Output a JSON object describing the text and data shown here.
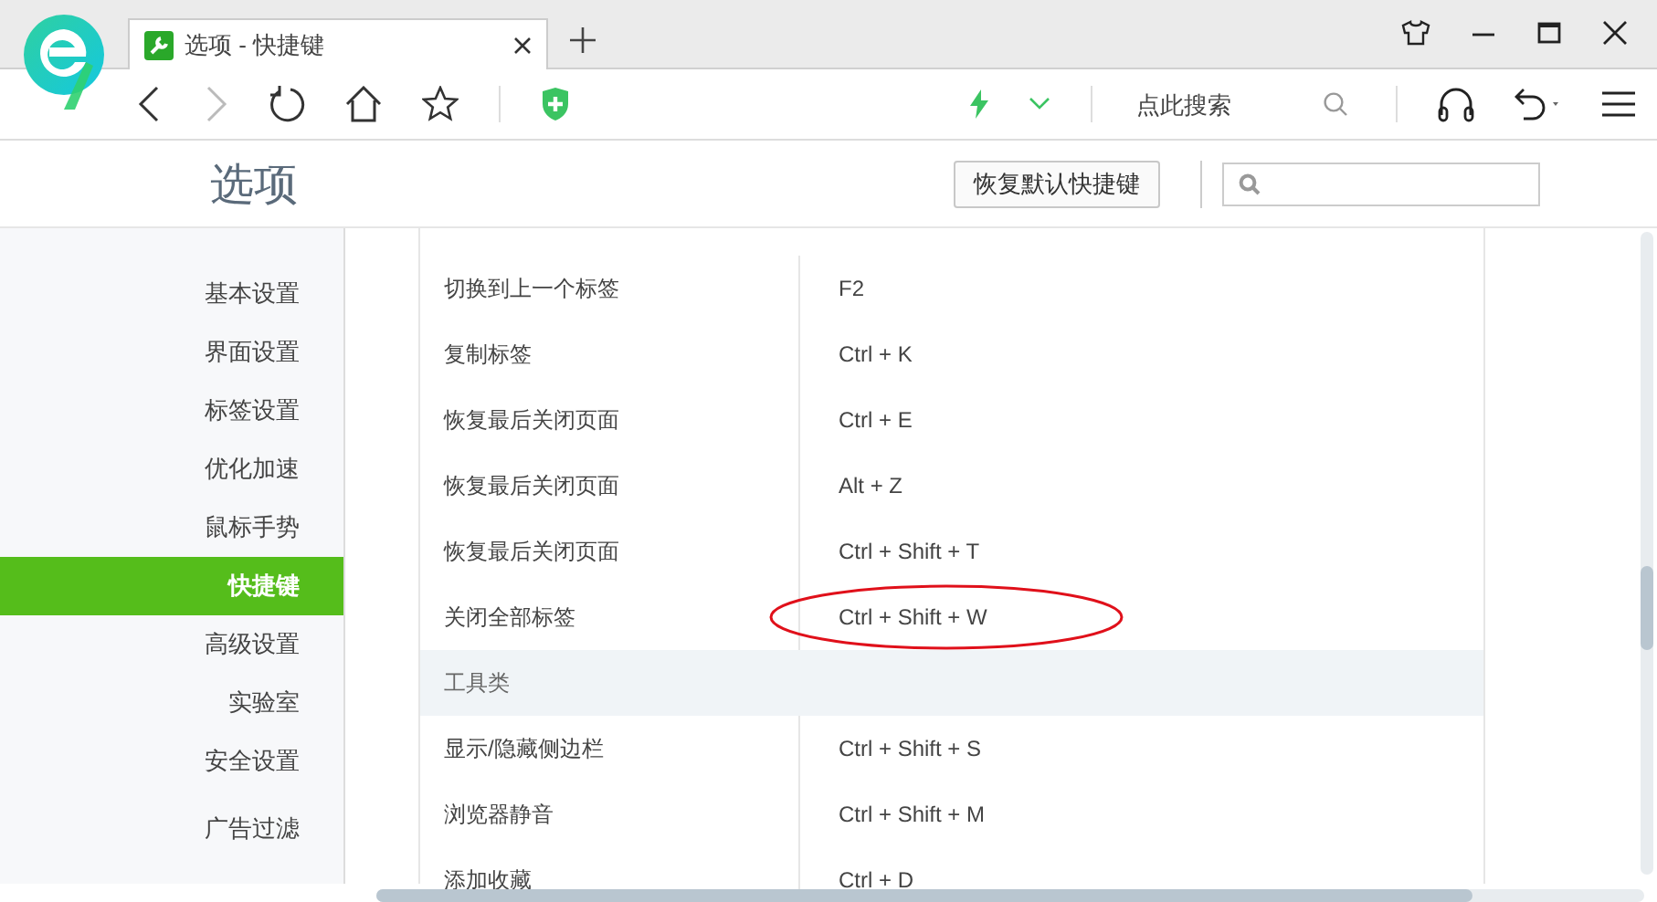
{
  "tab": {
    "title": "选项 - 快捷键",
    "selected": true
  },
  "toolbar": {
    "search_placeholder": "点此搜索"
  },
  "page": {
    "title": "选项",
    "reset_button": "恢复默认快捷键"
  },
  "sidebar": {
    "items": [
      {
        "label": "基本设置",
        "selected": false
      },
      {
        "label": "界面设置",
        "selected": false
      },
      {
        "label": "标签设置",
        "selected": false
      },
      {
        "label": "优化加速",
        "selected": false
      },
      {
        "label": "鼠标手势",
        "selected": false
      },
      {
        "label": "快捷键",
        "selected": true
      },
      {
        "label": "高级设置",
        "selected": false
      },
      {
        "label": "实验室",
        "selected": false
      },
      {
        "label": "安全设置",
        "selected": false
      },
      {
        "label": "广告过滤",
        "selected": false
      }
    ]
  },
  "shortcuts": [
    {
      "kind": "shortcut",
      "action": "切换到上一个标签",
      "keys": "F2",
      "circled": false
    },
    {
      "kind": "shortcut",
      "action": "复制标签",
      "keys": "Ctrl + K",
      "circled": false
    },
    {
      "kind": "shortcut",
      "action": "恢复最后关闭页面",
      "keys": "Ctrl + E",
      "circled": false
    },
    {
      "kind": "shortcut",
      "action": "恢复最后关闭页面",
      "keys": "Alt + Z",
      "circled": false
    },
    {
      "kind": "shortcut",
      "action": "恢复最后关闭页面",
      "keys": "Ctrl + Shift + T",
      "circled": false
    },
    {
      "kind": "shortcut",
      "action": "关闭全部标签",
      "keys": "Ctrl + Shift + W",
      "circled": true
    },
    {
      "kind": "category",
      "action": "工具类"
    },
    {
      "kind": "shortcut",
      "action": "显示/隐藏侧边栏",
      "keys": "Ctrl + Shift + S",
      "circled": false
    },
    {
      "kind": "shortcut",
      "action": "浏览器静音",
      "keys": "Ctrl + Shift + M",
      "circled": false
    },
    {
      "kind": "shortcut",
      "action": "添加收藏",
      "keys": "Ctrl + D",
      "circled": false
    }
  ]
}
